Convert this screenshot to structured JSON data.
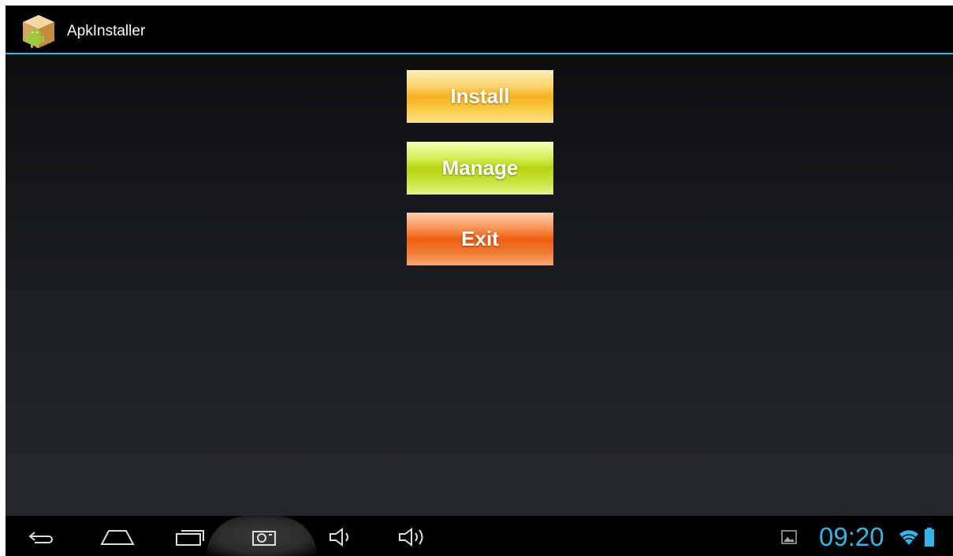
{
  "action_bar": {
    "title": "ApkInstaller",
    "icon": "apk-installer-app-icon"
  },
  "buttons": {
    "install_label": "Install",
    "manage_label": "Manage",
    "exit_label": "Exit"
  },
  "colors": {
    "accent": "#33b5e5",
    "install": "#f5b120",
    "manage": "#b7d40f",
    "exit": "#ee5e10"
  },
  "nav_bar": {
    "icons": [
      "back-icon",
      "home-icon",
      "recent-apps-icon",
      "screenshot-icon",
      "volume-down-icon",
      "volume-up-icon"
    ],
    "status_icons": [
      "gallery-notification-icon",
      "wifi-icon",
      "battery-icon"
    ],
    "clock": "09:20"
  }
}
